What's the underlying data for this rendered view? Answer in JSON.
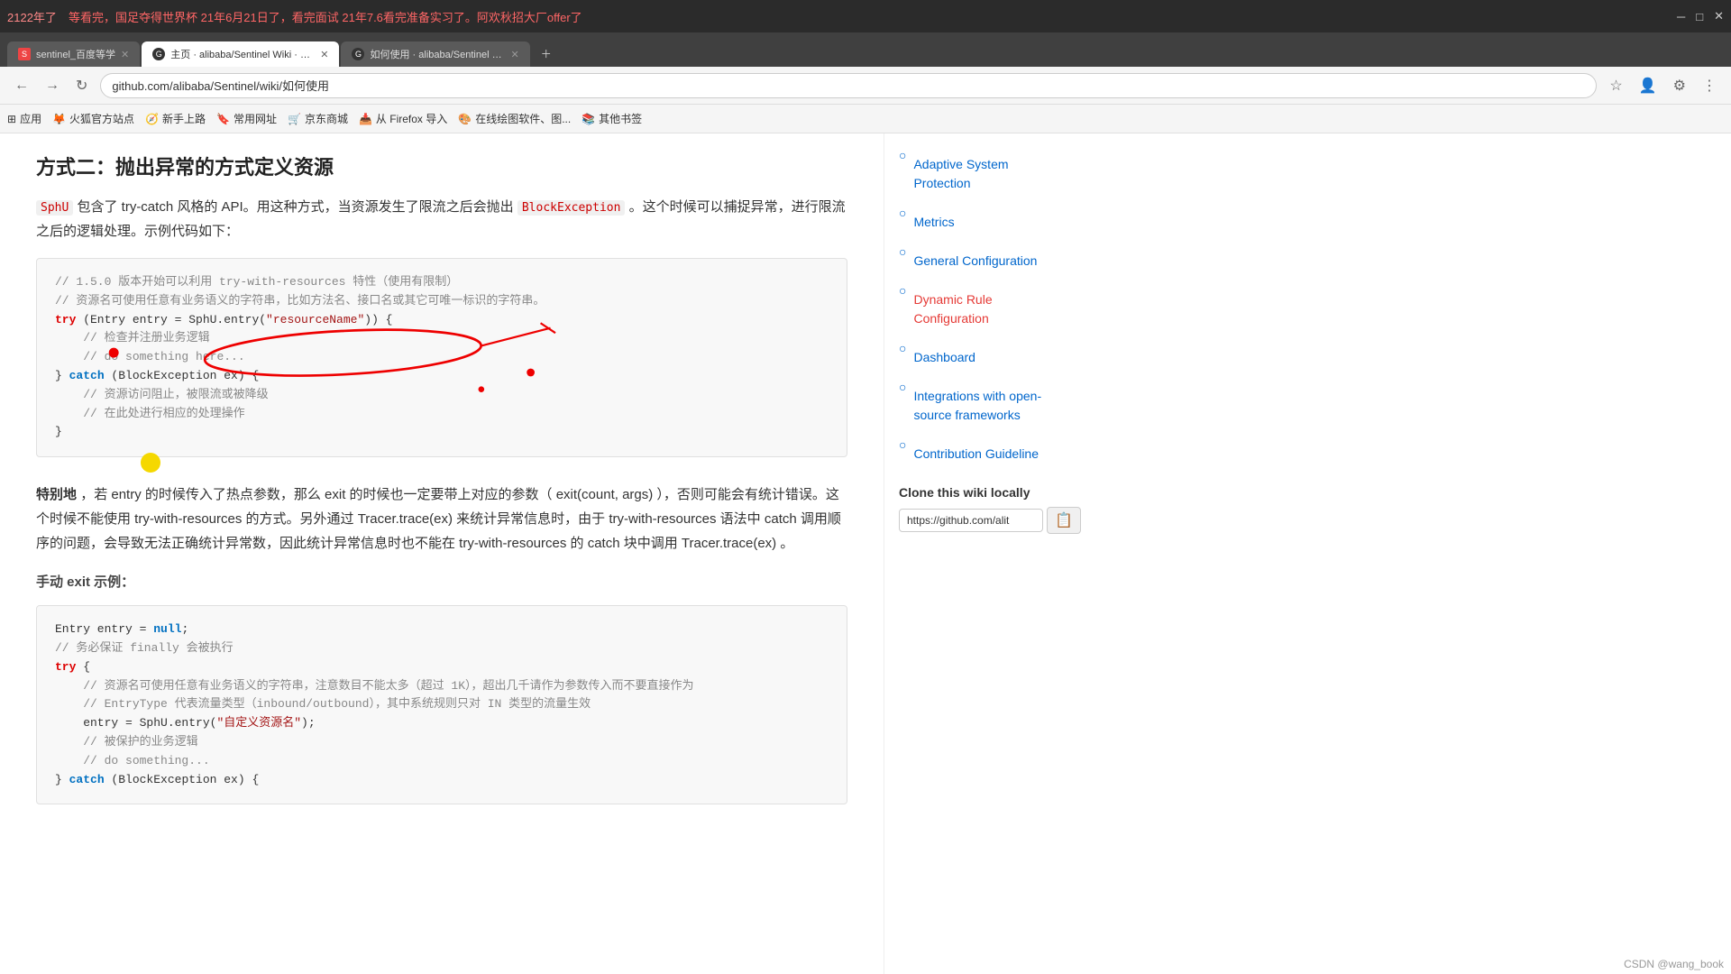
{
  "browser": {
    "top_bar_left": "2122年了",
    "top_bar_marquee": "等看完，国足夺得世界杯  21年6月21日了，看完面试   21年7.6看完准备实习了。阿欢秋招大厂offer了",
    "tabs": [
      {
        "id": "tab1",
        "label": "sentinel_百度等学",
        "favicon": "s",
        "active": false,
        "url": "github.com/alibaba/Sentinel Wiki"
      },
      {
        "id": "tab2",
        "label": "主页 · alibaba/Sentinel Wiki · G...",
        "favicon": "g",
        "active": true,
        "url": "github.com/alibaba/Sentinel/wiki/如何使用"
      },
      {
        "id": "tab3",
        "label": "如何使用 · alibaba/Sentinel Wi...",
        "favicon": "g",
        "active": false,
        "url": ""
      }
    ],
    "address": "github.com/alibaba/Sentinel/wiki/如何使用",
    "bookmarks": [
      {
        "label": "应用",
        "icon": "⬜"
      },
      {
        "label": "火狐官方站点",
        "icon": "🦊"
      },
      {
        "label": "新手上路",
        "icon": "🧭"
      },
      {
        "label": "常用网址",
        "icon": "🔖"
      },
      {
        "label": "京东商城",
        "icon": "🛒"
      },
      {
        "label": "从 Firefox 导入",
        "icon": "📥"
      },
      {
        "label": "在线绘图软件、图...",
        "icon": "🎨"
      },
      {
        "label": "其他书签",
        "icon": "📚"
      }
    ]
  },
  "sidebar": {
    "links": [
      {
        "id": "adaptive",
        "label": "Adaptive System Protection",
        "active": false
      },
      {
        "id": "metrics",
        "label": "Metrics",
        "active": false
      },
      {
        "id": "general",
        "label": "General Configuration",
        "active": false
      },
      {
        "id": "dynamic",
        "label": "Dynamic Rule Configuration",
        "active": false
      },
      {
        "id": "dashboard",
        "label": "Dashboard",
        "active": false
      },
      {
        "id": "integrations",
        "label": "Integrations with open-source frameworks",
        "active": false
      },
      {
        "id": "contribution",
        "label": "Contribution Guideline",
        "active": false
      }
    ],
    "clone_section": {
      "title": "Clone this wiki locally",
      "url": "https://github.com/alit"
    }
  },
  "article": {
    "section_title": "方式二：抛出异常的方式定义资源",
    "intro_para": "SphU 包含了 try-catch 风格的 API。用这种方式，当资源发生了限流之后会抛出 BlockException 。这个时候可以捕捉异常，进行限流之后的逻辑处理。示例代码如下：",
    "code_block1_lines": [
      "// 1.5.0 版本开始可以利用 try-with-resources 特性（使用有限制）",
      "// 资源名可使用任意有业务语义的字符串，比如方法名、接口名或其它可唯一标识的字符串。",
      "try (Entry entry = SphU.entry(\"resourceName\")) {",
      "    // 检查并注册业务逻辑",
      "    // do something here...",
      "} catch (BlockException ex) {",
      "    // 资源访问阻止，被限流或被降级",
      "    // 在此处进行相应的处理操作",
      "}"
    ],
    "middle_para": "特别地，若 entry 的时候传入了热点参数，那么 exit 的时候也一定要带上对应的参数（ exit(count, args) ），否则可能会有统计错误。这个时候不能使用 try-with-resources 的方式。另外通过 Tracer.trace(ex) 来统计异常信息时，由于 try-with-resources 语法中 catch 调用顺序的问题，会导致无法正确统计异常数，因此统计异常信息时也不能在 try-with-resources 的 catch 块中调用 Tracer.trace(ex) 。",
    "manual_exit_title": "手动 exit 示例：",
    "code_block2_lines": [
      "Entry entry = null;",
      "// 务必保证 finally 会被执行",
      "try {",
      "    // 资源名可使用任意有业务语义的字符串，注意数目不能太多（超过 1K），超出几千请作为参数传入而不要直接作为",
      "    // EntryType 代表流量类型（inbound/outbound），其中系统规则只对 IN 类型的流量生效",
      "    entry = SphU.entry(\"自定义资源名\");",
      "    // 被保护的业务逻辑",
      "    // do something...",
      "} catch (BlockException ex) {"
    ],
    "csdn_mark": "CSDN @wang_book"
  }
}
